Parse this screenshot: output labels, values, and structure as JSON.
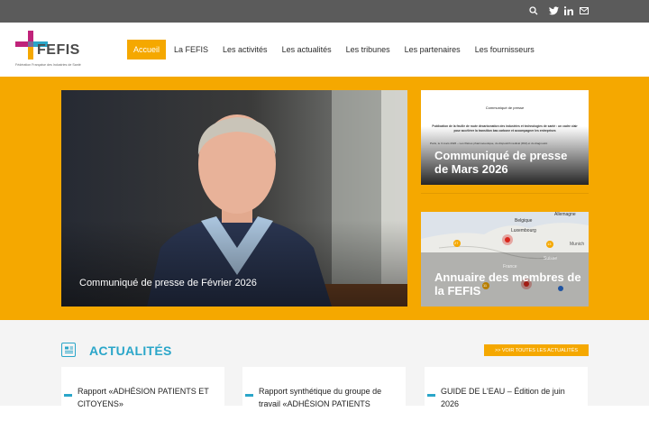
{
  "header": {
    "logo_text": "FEFIS",
    "logo_tagline": "Fédération Française des Industries de Santé",
    "topbar_icons": [
      "search-icon",
      "twitter-icon",
      "linkedin-icon",
      "mail-icon"
    ]
  },
  "nav": {
    "items": [
      "Accueil",
      "La FEFIS",
      "Les activités",
      "Les actualités",
      "Les tribunes",
      "Les partenaires",
      "Les fournisseurs"
    ],
    "active": "Accueil"
  },
  "hero": {
    "main_caption": "Communiqué de presse de Février 2026",
    "card1_caption": "Communiqué de presse de Mars 2026",
    "card1_doc_title": "Communiqué de presse",
    "card1_doc_heading": "Publication de la feuille de route décarbonation des industries et technologies de santé : un cadre clair pour accélérer la transition bas carbone et accompagner les entreprises",
    "card1_doc_body": "Paris, le 3 mars 2026 – Les filières pharmaceutique, du dispositif médical (DM) et du diagnostic",
    "card2_caption": "Annuaire des membres de la FEFIS",
    "card2_map_labels": [
      "Allemagne",
      "Belgique",
      "Luxembourg",
      "France",
      "Suisse",
      "Munich"
    ],
    "card2_counts": [
      "27",
      "13",
      "11"
    ]
  },
  "news": {
    "title": "ACTUALITÉS",
    "see_all": ">> VOIR TOUTES LES ACTUALITÉS",
    "items": [
      "Rapport «ADHÉSION PATIENTS ET CITOYENS»",
      "Rapport synthétique du groupe de travail «ADHÉSION PATIENTS",
      "GUIDE DE L'EAU – Édition de juin 2026"
    ]
  },
  "colors": {
    "accent": "#f5a800",
    "teal": "#2aa6c9",
    "topbar": "#5b5b5b",
    "logo_magenta": "#c0237a",
    "logo_teal": "#2aa6c9"
  }
}
